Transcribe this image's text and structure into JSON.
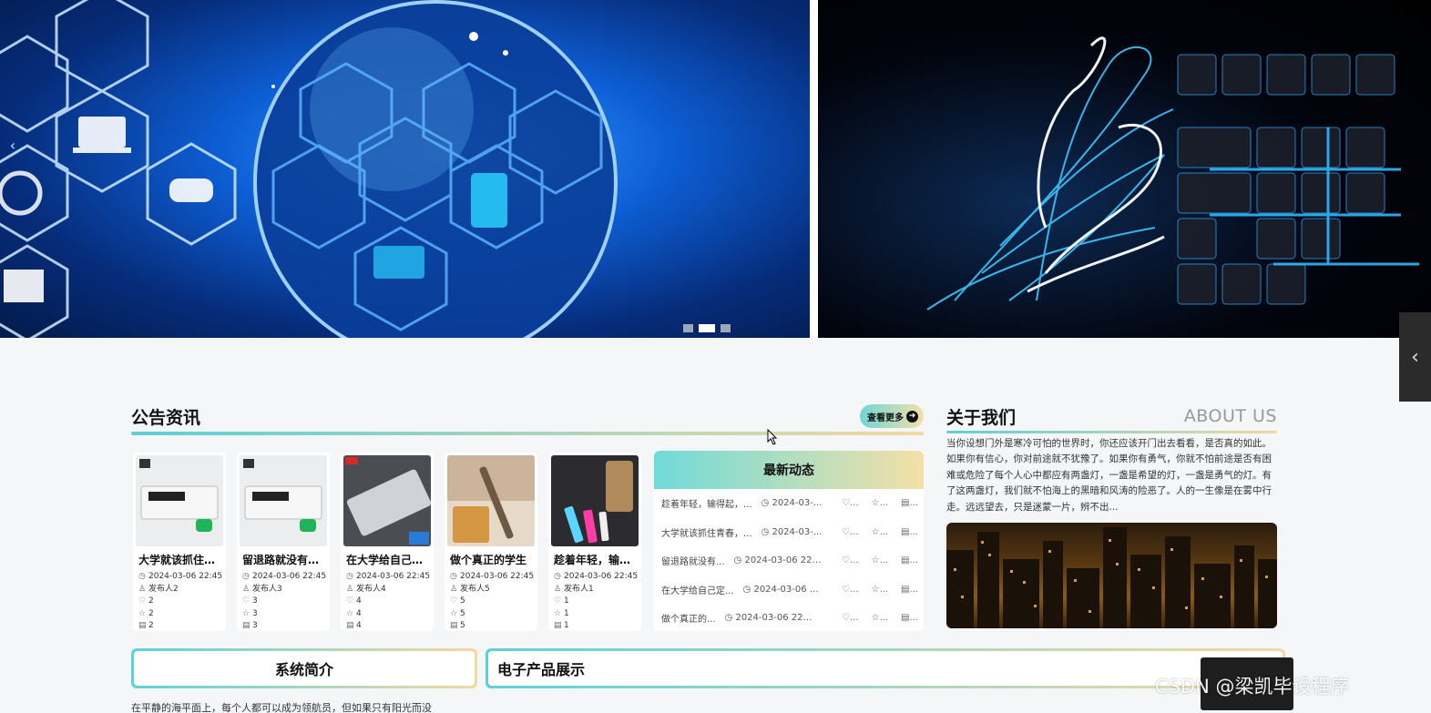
{
  "banner": {
    "prev_arrow": "‹",
    "dots": 3,
    "active_dot": 1
  },
  "notice": {
    "title": "公告资讯",
    "more_label": "查看更多",
    "cards": [
      {
        "title": "大学就该抓住青春",
        "date": "2024-03-06 22:45",
        "publisher": "发布人2",
        "likes": "2",
        "favorites": "2",
        "views": "2"
      },
      {
        "title": "留退路就没有退路",
        "date": "2024-03-06 22:45",
        "publisher": "发布人3",
        "likes": "3",
        "favorites": "3",
        "views": "3"
      },
      {
        "title": "在大学给自己定个目标",
        "date": "2024-03-06 22:45",
        "publisher": "发布人4",
        "likes": "4",
        "favorites": "4",
        "views": "4"
      },
      {
        "title": "做个真正的学生",
        "date": "2024-03-06 22:45",
        "publisher": "发布人5",
        "likes": "5",
        "favorites": "5",
        "views": "5"
      },
      {
        "title": "趁着年轻，输得起",
        "date": "2024-03-06 22:45",
        "publisher": "发布人1",
        "likes": "1",
        "favorites": "1",
        "views": "1"
      }
    ]
  },
  "news": {
    "title": "最新动态",
    "items": [
      {
        "title": "趁着年轻，输得起，...",
        "date": "2024-03-...",
        "likes": "...",
        "favorites": "...",
        "views": "..."
      },
      {
        "title": "大学就该抓住青春，...",
        "date": "2024-03-...",
        "likes": "...",
        "favorites": "...",
        "views": "..."
      },
      {
        "title": "留退路就没有...",
        "date": "2024-03-06 22:...",
        "likes": "...",
        "favorites": "...",
        "views": "..."
      },
      {
        "title": "在大学给自己定...",
        "date": "2024-03-06 2...",
        "likes": "...",
        "favorites": "...",
        "views": "..."
      },
      {
        "title": "做个真正的...",
        "date": "2024-03-06 22:...",
        "likes": "...",
        "favorites": "...",
        "views": "..."
      }
    ]
  },
  "about": {
    "title": "关于我们",
    "title_en": "ABOUT US",
    "text": "当你设想门外是寒冷可怕的世界时，你还应该开门出去看看，是否真的如此。如果你有信心，你对前途就不犹豫了。如果你有勇气，你就不怕前途是否有困难或危险了每个人心中都应有两盏灯，一盏是希望的灯，一盏是勇气的灯。有了这两盏灯，我们就不怕海上的黑暗和风涛的险恶了。人的一生像是在雾中行走。远远望去，只是迷蒙一片，辨不出..."
  },
  "intro": {
    "title": "系统简介",
    "text": "在平静的海平面上，每个人都可以成为领航员，但如果只有阳光而没"
  },
  "products": {
    "title": "电子产品展示"
  },
  "side_tab": "‹",
  "watermark": "CSDN @梁凯毕设程序",
  "colors": {
    "accent_start": "#5ccfd4",
    "accent_end": "#f1d9a3"
  }
}
